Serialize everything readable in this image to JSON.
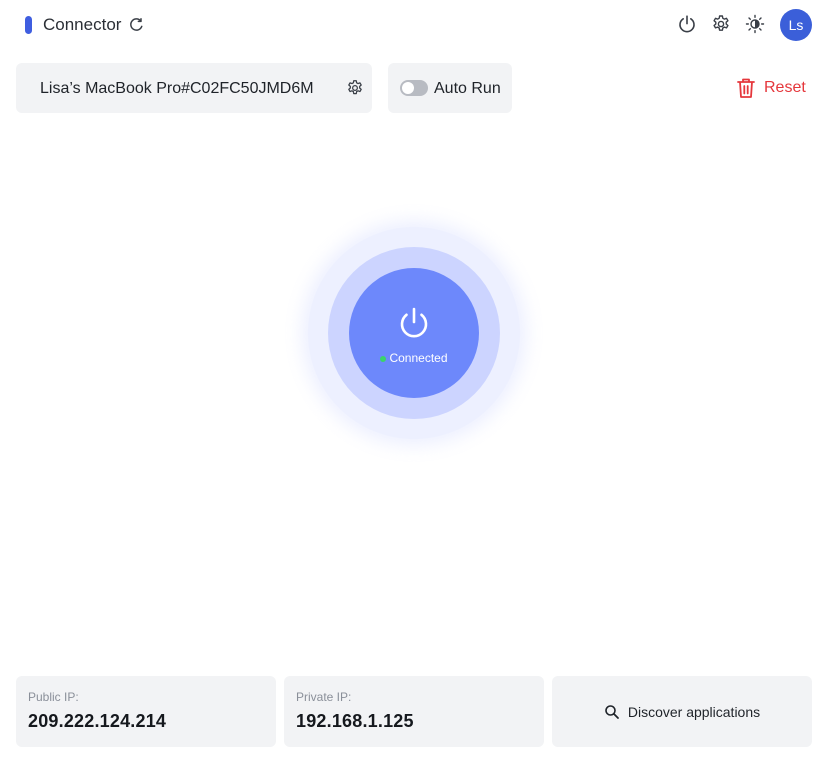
{
  "header": {
    "title": "Connector",
    "avatar_initials": "Ls",
    "icons": [
      "refresh-icon",
      "power-icon",
      "gear-icon",
      "theme-icon"
    ]
  },
  "toolbar": {
    "device_name": "Lisa’s MacBook Pro#C02FC50JMD6M",
    "auto_run_label": "Auto Run",
    "auto_run_enabled": false,
    "reset_label": "Reset"
  },
  "connection": {
    "status_label": "Connected",
    "status_color": "#3ad46a"
  },
  "footer": {
    "public_ip_label": "Public IP:",
    "public_ip": "209.222.124.214",
    "private_ip_label": "Private IP:",
    "private_ip": "192.168.1.125",
    "discover_label": "Discover applications"
  },
  "colors": {
    "accent": "#3f5ee0",
    "power_button": "#6d88fb",
    "danger": "#e5373c",
    "card_bg": "#f2f3f5"
  }
}
